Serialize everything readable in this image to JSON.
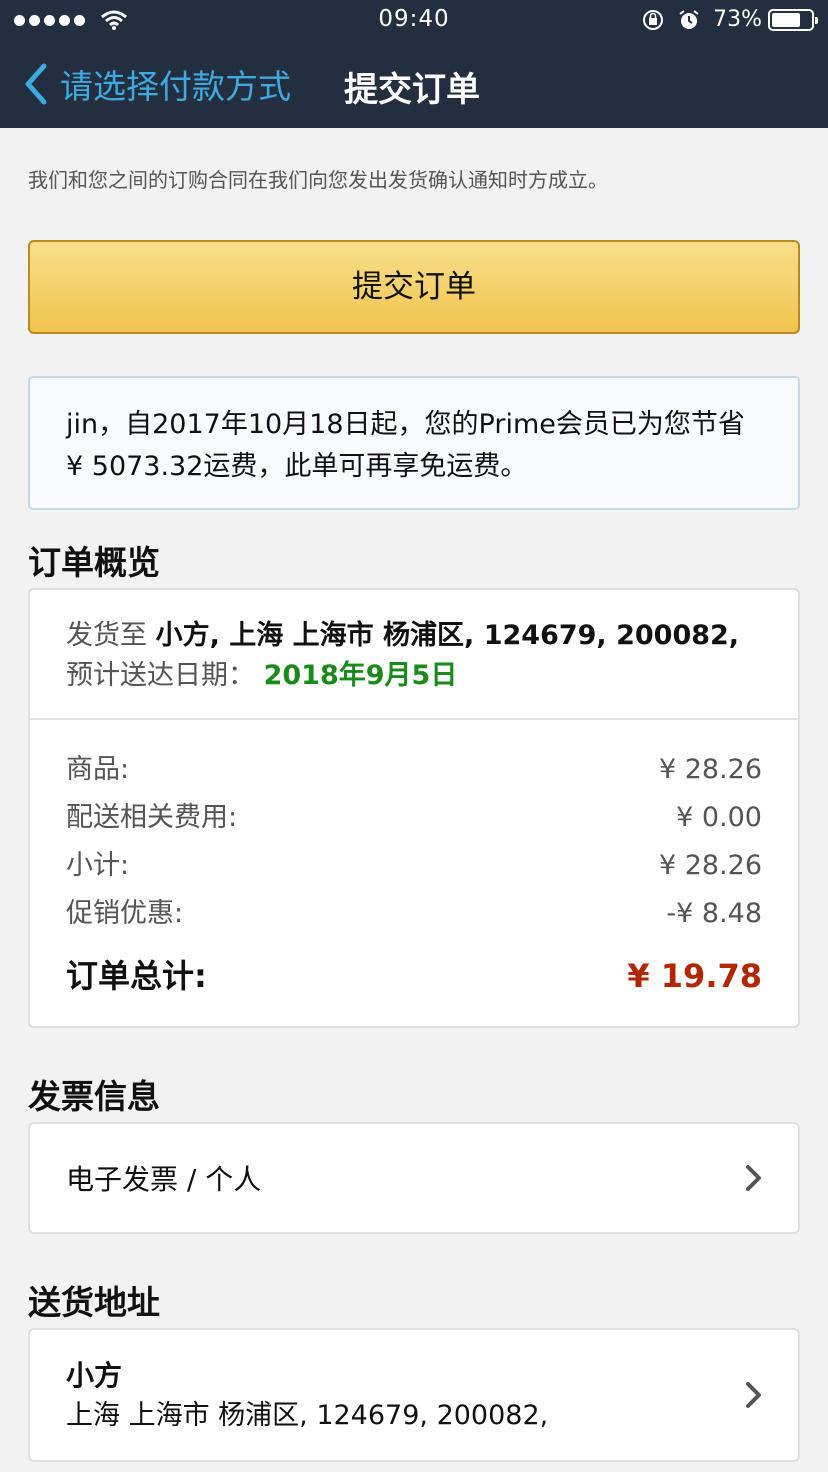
{
  "status_bar": {
    "time": "09:40",
    "battery_percent": "73%",
    "battery_level": 0.73,
    "signal_dots": 5
  },
  "nav": {
    "back_label": "请选择付款方式",
    "title": "提交订单"
  },
  "notice": "我们和您之间的订购合同在我们向您发出发货确认通知时方成立。",
  "submit_button_label": "提交订单",
  "prime_message": "jin，自2017年10月18日起，您的Prime会员已为您节省¥ 5073.32运费，此单可再享免运费。",
  "order_overview": {
    "title": "订单概览",
    "ship_to_label": "发货至",
    "ship_to_value": "小方, 上海 上海市 杨浦区, 124679, 200082,",
    "eta_label": "预计送达日期：",
    "eta_value": "2018年9月5日",
    "rows": [
      {
        "label": "商品:",
        "value": "¥ 28.26"
      },
      {
        "label": "配送相关费用:",
        "value": "¥ 0.00"
      },
      {
        "label": "小计:",
        "value": "¥ 28.26"
      },
      {
        "label": "促销优惠:",
        "value": "-¥ 8.48"
      }
    ],
    "total_label": "订单总计:",
    "total_value": "¥ 19.78"
  },
  "invoice": {
    "title": "发票信息",
    "value": "电子发票 / 个人"
  },
  "shipping_address": {
    "title": "送货地址",
    "name": "小方",
    "line": "上海 上海市 杨浦区, 124679, 200082,"
  },
  "colors": {
    "nav_bg": "#232f3e",
    "accent_blue": "#3fa9e1",
    "button_yellow": "#f1c44d",
    "price_red": "#b12704",
    "eta_green": "#1b8a1b"
  },
  "icons": [
    "wifi-icon",
    "orientation-lock-icon",
    "alarm-icon",
    "battery-icon",
    "back-chevron-icon",
    "chevron-right-icon"
  ]
}
